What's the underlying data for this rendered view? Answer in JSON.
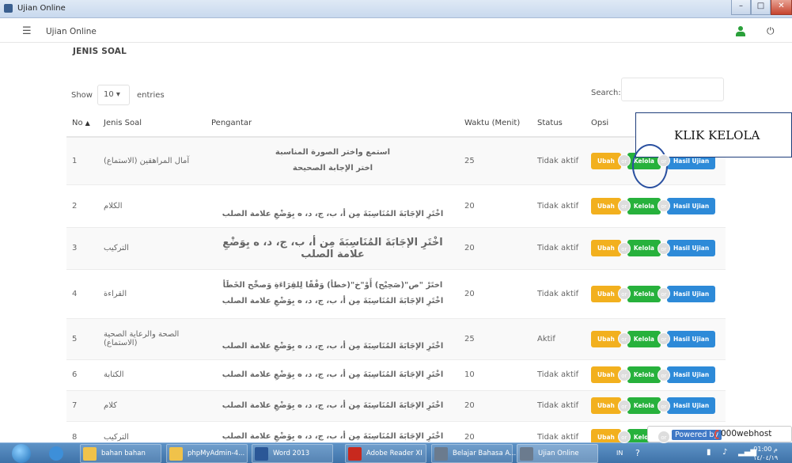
{
  "window": {
    "title": "Ujian Online",
    "buttons": [
      "–",
      "□",
      "✕"
    ]
  },
  "appbar": {
    "title": "Ujian Online"
  },
  "page": {
    "heading": "JENIS SOAL"
  },
  "controls": {
    "show_label": "Show",
    "entries_value": "10",
    "entries_label": "entries",
    "search_label": "Search:",
    "search_value": ""
  },
  "table": {
    "headers": {
      "no": "No",
      "jenis": "Jenis Soal",
      "pengantar": "Pengantar",
      "waktu": "Waktu (Menit)",
      "status": "Status",
      "opsi": "Opsi"
    },
    "rows": [
      {
        "no": "1",
        "jenis": "آمال المراهقين (الاستماع)",
        "pengantar": [
          "استمع واختر الصورة المناسبة",
          "اختر الإجابة الصحيحة"
        ],
        "waktu": "25",
        "status": "Tidak aktif"
      },
      {
        "no": "2",
        "jenis": "الكلام",
        "pengantar": [
          "اخْتَرِ الإجَابَةَ المُنَاسِبَةَ مِن أ، ب، ج، د، ه بِوَضْعِ علامة الصلب"
        ],
        "waktu": "20",
        "status": "Tidak aktif"
      },
      {
        "no": "3",
        "jenis": "التركيب",
        "pengantar": [
          "اخْتَرِ الإجَابَةَ المُنَاسِبَةَ مِن أ، ب، ج، د، ه بِوَضْعِ علامة الصلب"
        ],
        "waktu": "20",
        "status": "Tidak aktif"
      },
      {
        "no": "4",
        "jenis": "القراءة",
        "pengantar": [
          "اختَرْ \"ص\"(صَحِيْح) أَوْ\"خ\"(خطأ) وَفْقًا لِلقِرَاءَةِ وَصحِّح الخَطَأ",
          "اخْتَرِ الإجَابَةَ المُنَاسِبَةَ مِن أ، ب، ج، د، ه بِوَضْعِ علامة الصلب"
        ],
        "waktu": "20",
        "status": "Tidak aktif"
      },
      {
        "no": "5",
        "jenis": "الصحة والرعاية الصحية (الاستماع)",
        "pengantar": [
          "اخْتَرِ الإجَابَةَ المُنَاسِبَةَ مِن أ، ب، ج، د، ه بِوَضْعِ علامة الصلب"
        ],
        "waktu": "25",
        "status": "Aktif"
      },
      {
        "no": "6",
        "jenis": "الكتابة",
        "pengantar": [
          "اخْتَرِ الإجَابَةَ المُنَاسِبَةَ مِن أ، ب، ج، د، ه بِوَضْعِ علامة الصلب"
        ],
        "waktu": "10",
        "status": "Tidak aktif"
      },
      {
        "no": "7",
        "jenis": "كلام",
        "pengantar": [
          "اخْتَرِ الإجَابَةَ المُنَاسِبَةَ مِن أ، ب، ج، د، ه بِوَضْعِ علامة الصلب"
        ],
        "waktu": "20",
        "status": "Tidak aktif"
      },
      {
        "no": "8",
        "jenis": "التركيب",
        "pengantar": [
          "اخْتَرِ الإجَابَةَ المُنَاسِبَةَ مِن أ، ب، ج، د، ه بِوَضْعِ علامة الصلب"
        ],
        "waktu": "20",
        "status": "Tidak aktif"
      }
    ],
    "buttons": {
      "ubah": "Ubah",
      "or": "or",
      "kelola": "Kelola",
      "hasil": "Hasil Ujian"
    }
  },
  "annotation": {
    "callout": "KLIK KELOLA"
  },
  "powered": {
    "label": "Powered by",
    "brand": "000webhost"
  },
  "taskbar": {
    "tasks": [
      "bahan bahan",
      "phpMyAdmin-4...",
      "Word 2013",
      "Adobe Reader XI",
      "Belajar Bahasa A...",
      "Ujian Online"
    ],
    "tray_lang": "IN",
    "clock_time": "01:00 م",
    "clock_date": "١٤/٠٤/١٩"
  },
  "colors": {
    "ubah": "#f2b01e",
    "kelola": "#27b13c",
    "hasil": "#2d8ad8",
    "user_icon": "#2aa03a"
  }
}
